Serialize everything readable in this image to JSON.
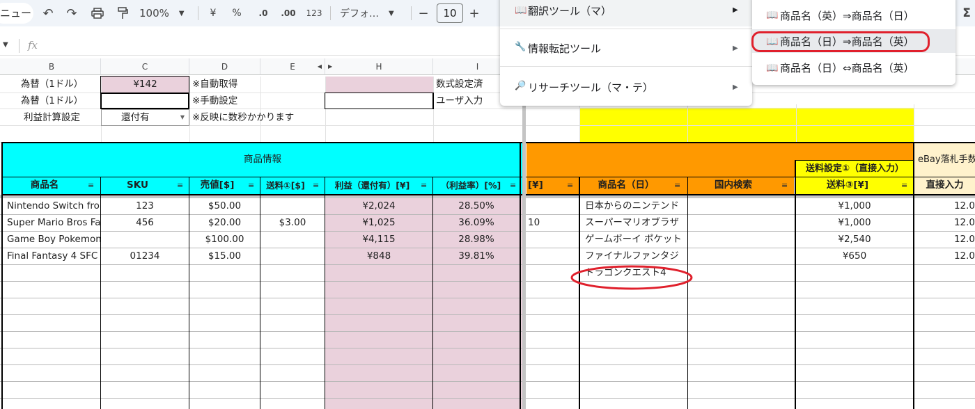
{
  "toolbar": {
    "menu_fragment": "ニュー",
    "zoom": "100%",
    "currency": "¥",
    "percent": "%",
    "dec_less": ".0",
    "dec_more": ".00",
    "num_format": "123",
    "font": "デフォ…",
    "font_size": "10",
    "minus": "−",
    "plus": "+",
    "sigma": "Σ"
  },
  "formula_bar": {
    "fx": "fx"
  },
  "columns": [
    "B",
    "C",
    "D",
    "E",
    "H",
    "I"
  ],
  "settings": {
    "rate_auto_label": "為替（1ドル）",
    "rate_auto_value": "¥142",
    "rate_auto_note": "※自動取得",
    "rate_manual_label": "為替（1ドル）",
    "rate_manual_note": "※手動設定",
    "profit_label": "利益計算設定",
    "profit_value": "還付有",
    "profit_note": "※反映に数秒かかります",
    "legend_formula": "数式設定済",
    "legend_user": "ユーザ入力"
  },
  "header": {
    "product_info": "商品情報",
    "shipping_group": "送料設定①（直接入力）",
    "ebay_group": "eBay落札手数",
    "cols": [
      "商品名",
      "SKU",
      "売値[$]",
      "送料①[$]",
      "利益（還付有）[¥]",
      "（利益率）[%]",
      "[¥]",
      "商品名（日）",
      "国内検索",
      "送料③[¥]",
      "直接入力"
    ]
  },
  "rows": [
    {
      "name": "Nintendo Switch from",
      "sku": "123",
      "price": "$50.00",
      "ship": "",
      "profit": "¥2,024",
      "rate": "28.50%",
      "j": "",
      "name_jp": "日本からのニンテンド",
      "search": "",
      "ship3": "¥1,000",
      "direct": "12.0"
    },
    {
      "name": "Super Mario Bros Fa",
      "sku": "456",
      "price": "$20.00",
      "ship": "$3.00",
      "profit": "¥1,025",
      "rate": "36.09%",
      "j": "10",
      "name_jp": "スーパーマリオブラザ",
      "search": "",
      "ship3": "¥1,000",
      "direct": "12.0"
    },
    {
      "name": "Game Boy Pokemon",
      "sku": "",
      "price": "$100.00",
      "ship": "",
      "profit": "¥4,115",
      "rate": "28.98%",
      "j": "",
      "name_jp": "ゲームボーイ ポケット",
      "search": "",
      "ship3": "¥2,540",
      "direct": "12.0"
    },
    {
      "name": "Final Fantasy 4 SFC",
      "sku": "01234",
      "price": "$15.00",
      "ship": "",
      "profit": "¥848",
      "rate": "39.81%",
      "j": "",
      "name_jp": "ファイナルファンタジ",
      "search": "",
      "ship3": "¥650",
      "direct": "12.0"
    },
    {
      "name": "",
      "sku": "",
      "price": "",
      "ship": "",
      "profit": "",
      "rate": "",
      "j": "",
      "name_jp": "ドラゴンクエスト4",
      "search": "",
      "ship3": "",
      "direct": ""
    }
  ],
  "menu": {
    "items": [
      "翻訳ツール（マ）",
      "情報転記ツール",
      "リサーチツール（マ・テ）"
    ]
  },
  "submenu": {
    "items": [
      "商品名（英）⇒商品名（日）",
      "商品名（日）⇒商品名（英）",
      "商品名（日）⇔商品名（英）"
    ]
  },
  "colors": {
    "cyan": "#00ffff",
    "pink": "#ead1dc",
    "orange": "#ff9900",
    "yellow": "#ffff00",
    "cream": "#fff2cc",
    "annotation": "#e0202c"
  }
}
